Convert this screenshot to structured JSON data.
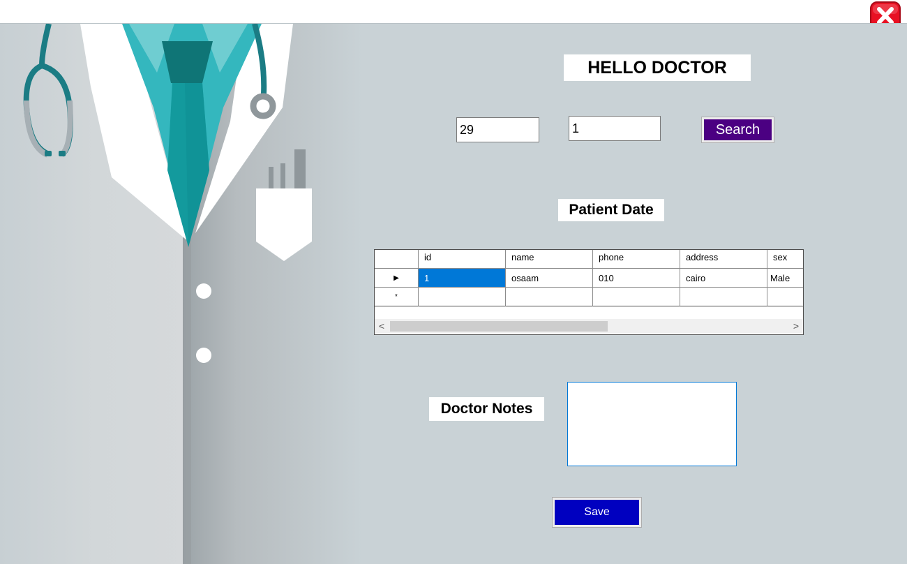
{
  "window": {
    "close_icon": "close-icon",
    "close_color": "#e81123"
  },
  "header": {
    "title": "HELLO DOCTOR"
  },
  "search": {
    "field1_value": "29",
    "field2_value": "1",
    "button_label": "Search",
    "button_color": "#4b0082"
  },
  "patient_section": {
    "label": "Patient Date"
  },
  "grid": {
    "columns": [
      "id",
      "name",
      "phone",
      "address",
      "sex"
    ],
    "rows": [
      {
        "id": "1",
        "name": "osaam",
        "phone": "010",
        "address": "cairo",
        "sex": "Male"
      }
    ],
    "selected_cell": "id",
    "current_row_marker": "▶",
    "new_row_marker": "*",
    "scroll_left": "<",
    "scroll_right": ">"
  },
  "notes": {
    "label": "Doctor Notes",
    "value": ""
  },
  "save": {
    "button_label": "Save",
    "button_color": "#0000c0"
  },
  "background": {
    "illustration": "doctor-coat-illustration",
    "accent": "#139a9d"
  }
}
